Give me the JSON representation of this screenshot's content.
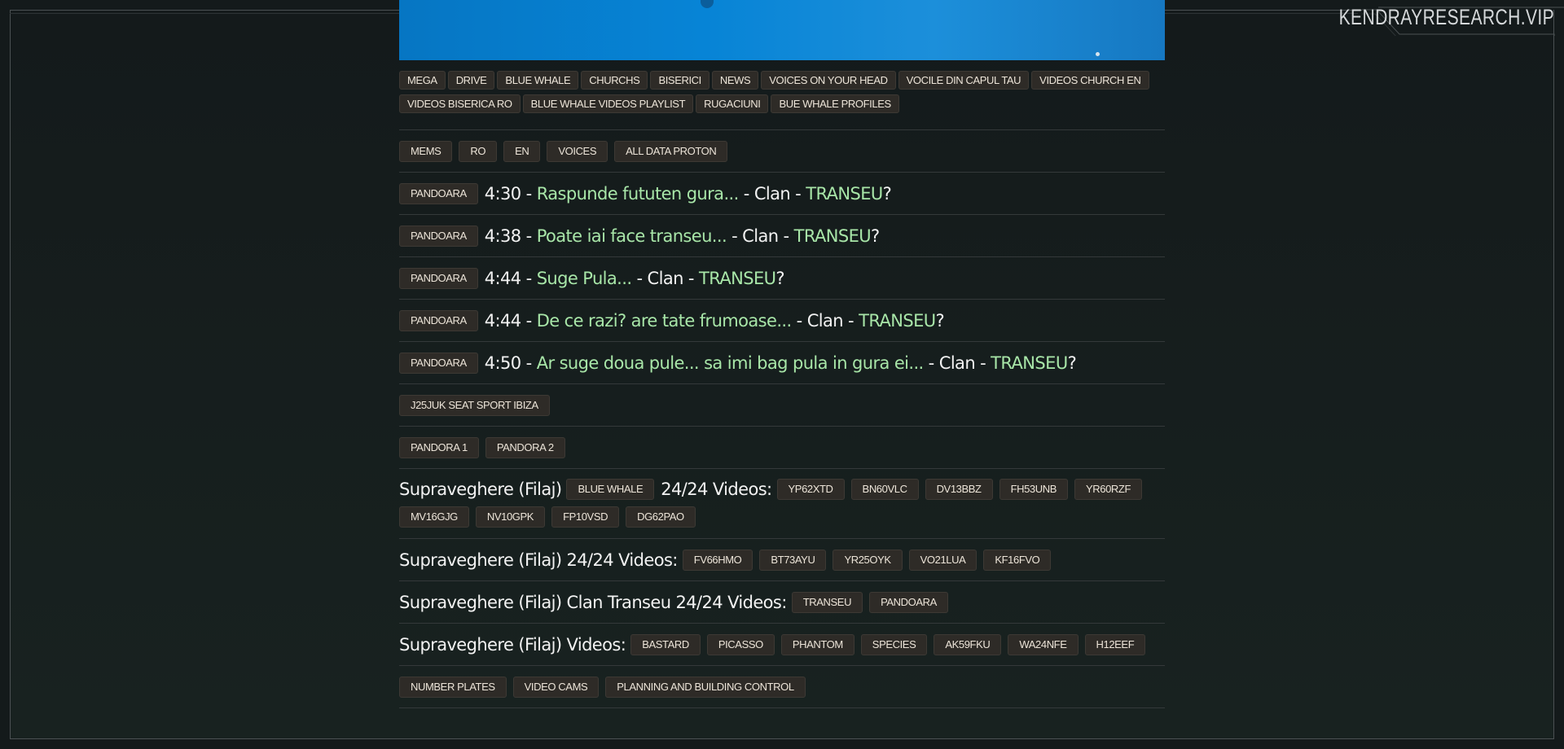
{
  "brand": "KENDRAYRESEARCH.VIP",
  "top_tags": [
    "MEGA",
    "DRIVE",
    "BLUE WHALE",
    "CHURCHS",
    "BISERICI",
    "NEWS",
    "VOICES ON YOUR HEAD",
    "VOCILE DIN CAPUL TAU",
    "VIDEOS CHURCH EN",
    "VIDEOS BISERICA RO",
    "BLUE WHALE VIDEOS PLAYLIST",
    "RUGACIUNI",
    "BUE WHALE PROFILES"
  ],
  "section_tags": [
    "MEMS",
    "RO",
    "EN",
    "VOICES",
    "ALL DATA PROTON"
  ],
  "entries": [
    {
      "tag": "PANDOARA",
      "time": "4:30",
      "quote": "Raspunde fututen gura...",
      "clan": "Clan",
      "group": "TRANSEU",
      "q": "?"
    },
    {
      "tag": "PANDOARA",
      "time": "4:38",
      "quote": "Poate iai face transeu...",
      "clan": "Clan",
      "group": "TRANSEU",
      "q": "?"
    },
    {
      "tag": "PANDOARA",
      "time": "4:44",
      "quote": "Suge Pula...",
      "clan": "Clan",
      "group": "TRANSEU",
      "q": "?"
    },
    {
      "tag": "PANDOARA",
      "time": "4:44",
      "quote": "De ce razi? are tate frumoase...",
      "clan": "Clan",
      "group": "TRANSEU",
      "q": "?"
    },
    {
      "tag": "PANDOARA",
      "time": "4:50",
      "quote": "Ar suge doua pule... sa imi bag pula in gura ei...",
      "clan": "Clan",
      "group": "TRANSEU",
      "q": "?"
    }
  ],
  "car_tag": "J25JUK SEAT SPORT IBIZA",
  "pandora_tags": [
    "PANDORA 1",
    "PANDORA 2"
  ],
  "surv1": {
    "label": "Supraveghere (Filaj)",
    "tag": "BLUE WHALE",
    "label2": "24/24 Videos:",
    "plates": [
      "YP62XTD",
      "BN60VLC",
      "DV13BBZ",
      "FH53UNB",
      "YR60RZF",
      "MV16GJG",
      "NV10GPK",
      "FP10VSD",
      "DG62PAO"
    ]
  },
  "surv2": {
    "label": "Supraveghere (Filaj) 24/24 Videos:",
    "plates": [
      "FV66HMO",
      "BT73AYU",
      "YR25OYK",
      "VO21LUA",
      "KF16FVO"
    ]
  },
  "surv3": {
    "label": "Supraveghere (Filaj) Clan Transeu 24/24 Videos:",
    "tags": [
      "TRANSEU",
      "PANDOARA"
    ]
  },
  "surv4": {
    "label": "Supraveghere (Filaj) Videos:",
    "tags": [
      "BASTARD",
      "PICASSO",
      "PHANTOM",
      "SPECIES",
      "AK59FKU",
      "WA24NFE",
      "H12EEF"
    ]
  },
  "bottom_tags": [
    "NUMBER PLATES",
    "VIDEO CAMS",
    "PLANNING AND BUILDING CONTROL"
  ]
}
